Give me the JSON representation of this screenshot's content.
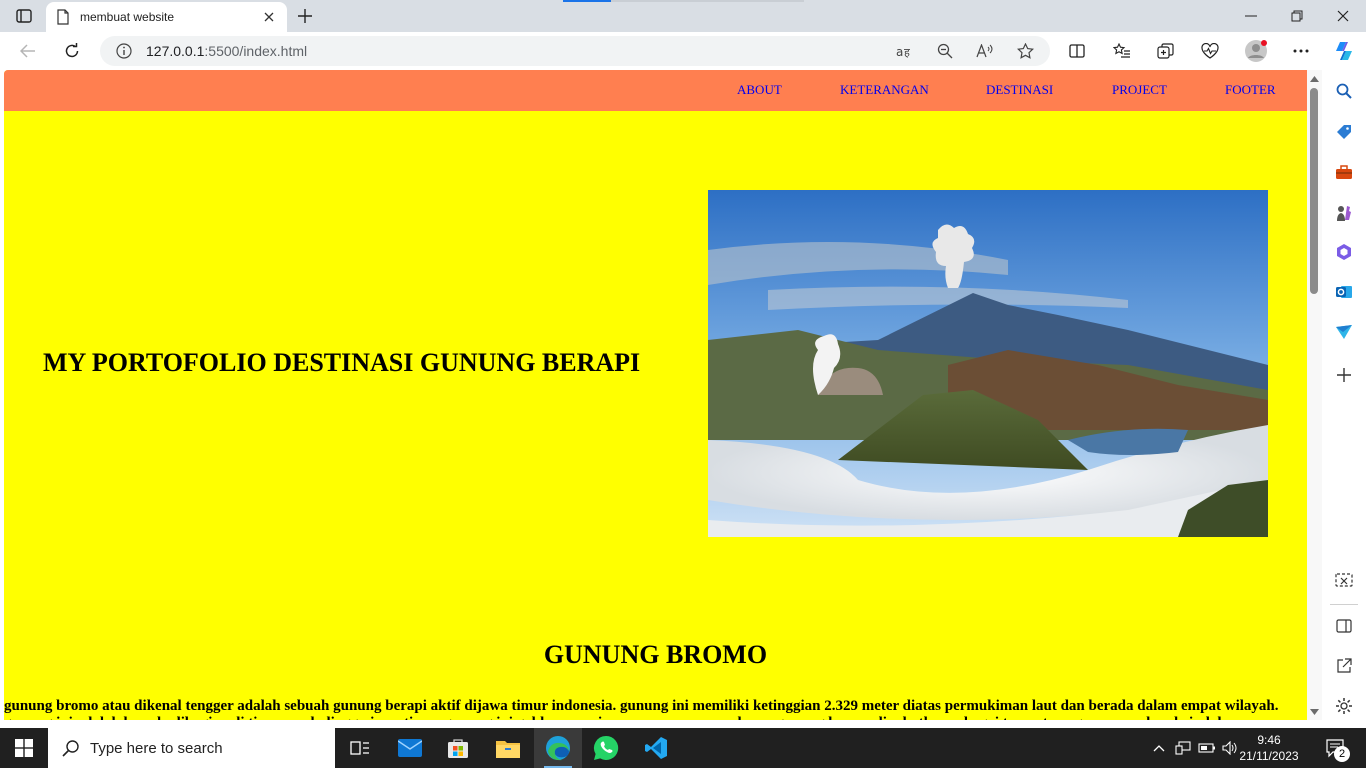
{
  "browser": {
    "tab_title": "membuat website",
    "url_host": "127.0.0.1",
    "url_path": ":5500/index.html"
  },
  "nav": {
    "items": [
      "ABOUT",
      "KETERANGAN",
      "DESTINASI",
      "PROJECT",
      "FOOTER"
    ]
  },
  "hero": {
    "title": "MY PORTOFOLIO DESTINASI GUNUNG BERAPI"
  },
  "section": {
    "title": "GUNUNG BROMO",
    "paragraph": "gunung bromo atau dikenal tengger adalah sebuah gunung berapi aktif dijawa timur indonesia. gunung ini memiliki ketinggian 2.329 meter diatas permukiman laut dan berada dalam empat wilayah. gunung ini adalah berada dibagian di timur probolinggo jawa timur gunung ini golden sunsrise nya pasarnya pasalnya , gunung bromo dinobatkan sebagai tempat yang menawarkan keindahan"
  },
  "taskbar": {
    "search_placeholder": "Type here to search",
    "time": "9:46",
    "date": "21/11/2023",
    "notification_count": "2"
  },
  "colors": {
    "page_bg": "#ffff00",
    "nav_bg": "#ff7f50",
    "nav_link": "#0000ee"
  }
}
